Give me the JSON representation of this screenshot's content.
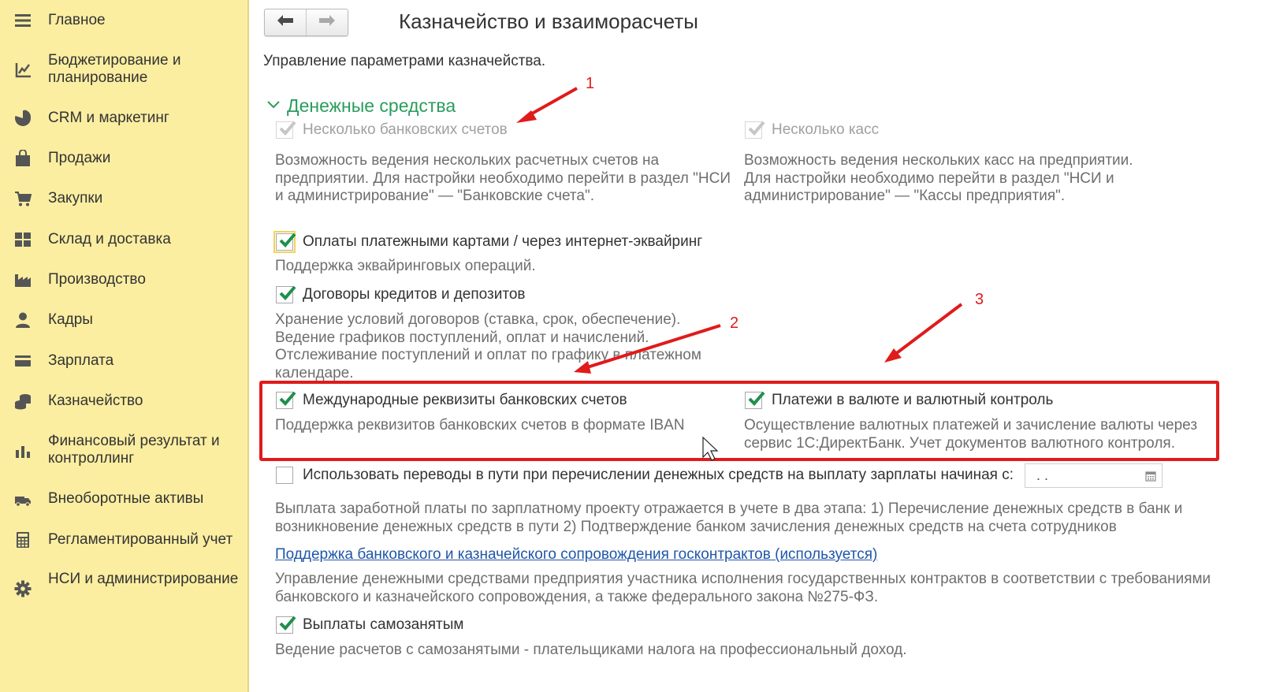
{
  "sidebar": {
    "items": [
      {
        "label": "Главное",
        "icon": "menu-icon"
      },
      {
        "label": "Бюджетирование и планирование",
        "icon": "budget-chart-icon"
      },
      {
        "label": "CRM и маркетинг",
        "icon": "pie-chart-icon"
      },
      {
        "label": "Продажи",
        "icon": "shopping-bag-icon"
      },
      {
        "label": "Закупки",
        "icon": "cart-icon"
      },
      {
        "label": "Склад и доставка",
        "icon": "warehouse-grid-icon"
      },
      {
        "label": "Производство",
        "icon": "factory-icon"
      },
      {
        "label": "Кадры",
        "icon": "person-icon"
      },
      {
        "label": "Зарплата",
        "icon": "wallet-card-icon"
      },
      {
        "label": "Казначейство",
        "icon": "coins-icon"
      },
      {
        "label": "Финансовый результат и контроллинг",
        "icon": "bar-chart-icon"
      },
      {
        "label": "Внеоборотные активы",
        "icon": "truck-icon"
      },
      {
        "label": "Регламентированный учет",
        "icon": "calculator-icon"
      },
      {
        "label": "НСИ и администрирование",
        "icon": "gear-icon"
      }
    ]
  },
  "header": {
    "title": "Казначейство и взаиморасчеты",
    "subtitle": "Управление параметрами казначейства."
  },
  "group": {
    "title": "Денежные средства"
  },
  "options": {
    "multiple_bank_accounts": {
      "label": "Несколько банковских счетов",
      "checked": true,
      "disabled": true,
      "desc": "Возможность ведения нескольких расчетных счетов на предприятии. Для настройки необходимо перейти в раздел \"НСИ и администрирование\" — \"Банковские счета\"."
    },
    "multiple_cash_desks": {
      "label": "Несколько касс",
      "checked": true,
      "disabled": true,
      "desc": "Возможность ведения нескольких касс на предприятии. Для настройки необходимо перейти в раздел \"НСИ и администрирование\" — \"Кассы предприятия\"."
    },
    "card_payments": {
      "label": "Оплаты платежными картами / через интернет-эквайринг",
      "checked": true,
      "desc": "Поддержка эквайринговых операций."
    },
    "loans_deposits": {
      "label": "Договоры кредитов и депозитов",
      "checked": true,
      "desc": "Хранение условий договоров (ставка, срок, обеспечение). Ведение графиков поступлений, оплат и начислений. Отслеживание поступлений и оплат по графику в платежном календаре."
    },
    "international_details": {
      "label": "Международные реквизиты банковских счетов",
      "checked": true,
      "desc": "Поддержка реквизитов банковских счетов в формате IBAN"
    },
    "currency_payments": {
      "label": "Платежи в валюте и валютный контроль",
      "checked": true,
      "desc": "Осуществление валютных платежей и зачисление валюты через сервис 1С:ДиректБанк. Учет документов валютного контроля."
    },
    "transfers_in_transit": {
      "label": "Использовать переводы в пути при перечислении денежных средств на выплату зарплаты начиная с:",
      "checked": false,
      "date_value": " .  .",
      "desc": "Выплата заработной платы по зарплатному проекту отражается в учете в два этапа: 1) Перечисление денежных средств в банк и возникновение денежных средств в пути 2) Подтверждение банком зачисления денежных средств на счета сотрудников"
    },
    "gov_contracts": {
      "link": "Поддержка банковского и казначейского сопровождения госконтрактов (используется)",
      "desc": "Управление денежными средствами предприятия участника исполнения государственных контрактов в соответствии с требованиями банковского и казначейского сопровождения, а также федерального закона №275-ФЗ."
    },
    "self_employed": {
      "label": "Выплаты самозанятым",
      "checked": true,
      "desc": "Ведение расчетов с самозанятыми - плательщиками налога на профессиональный доход."
    }
  },
  "annotations": {
    "marker_1": "1",
    "marker_2": "2",
    "marker_3": "3",
    "accent_color": "#e01b1b"
  },
  "colors": {
    "sidebar_bg": "#fbeea1",
    "group_title": "#2a9d5c",
    "checkmark": "#1f8f4e",
    "link": "#1f56a8"
  }
}
